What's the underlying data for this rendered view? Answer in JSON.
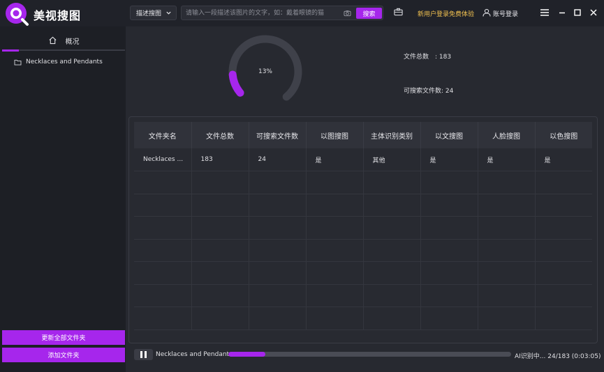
{
  "app": {
    "brand": "美视搜图"
  },
  "header": {
    "mode": "描述搜图",
    "search_placeholder": "请输入一段描述该图片的文字，如：戴着眼镜的猫",
    "search_label": "搜索",
    "promo": "新用户登录免费体验",
    "login": "账号登录"
  },
  "sidebar": {
    "tab_label": "概况",
    "folders": [
      {
        "label": "Necklaces and Pendants"
      }
    ],
    "update_all": "更新全部文件夹",
    "add_folder": "添加文件夹"
  },
  "overview": {
    "percent_label": "13%",
    "percent_value": 13,
    "total_files_label": "文件总数　: 183",
    "searchable_files_label": "可搜索文件数: 24"
  },
  "table": {
    "columns": [
      "文件夹名",
      "文件总数",
      "可搜索文件数",
      "以图搜图",
      "主体识别类别",
      "以文搜图",
      "人脸搜图",
      "以色搜图"
    ],
    "rows": [
      [
        "Necklaces ...",
        "183",
        "24",
        "是",
        "其他",
        "是",
        "是",
        "是"
      ]
    ]
  },
  "status": {
    "folder_label": "Necklaces and Pendants",
    "progress_value": 24,
    "progress_total": 183,
    "status_text": "AI识别中... 24/183 (0:03:05)"
  },
  "colors": {
    "accent": "#a626ec",
    "promo": "#f0c050",
    "background": "#23252d"
  }
}
